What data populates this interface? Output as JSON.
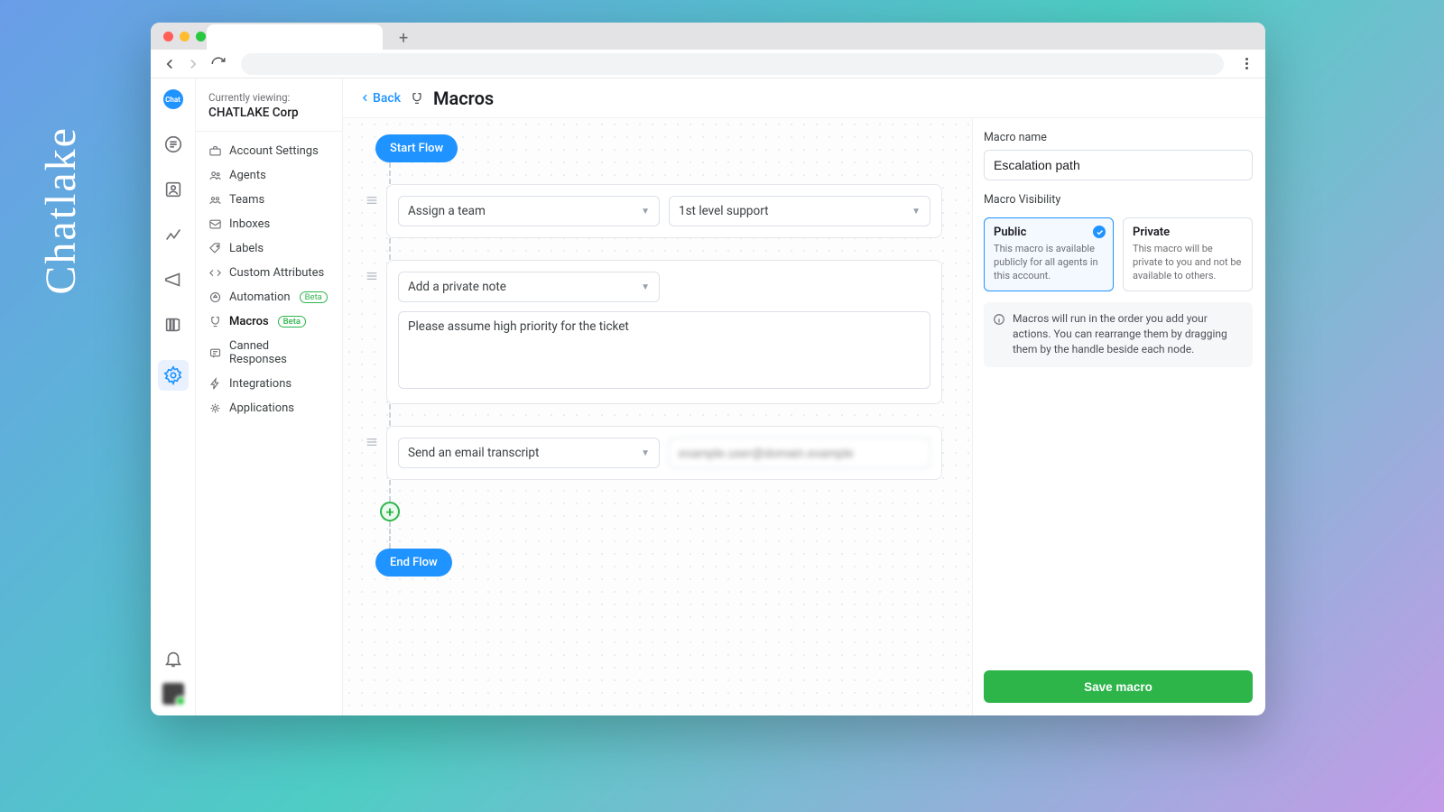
{
  "brand": "Chatlake",
  "browser": {
    "rail_logo_text": "Chat"
  },
  "side": {
    "viewing_label": "Currently viewing:",
    "org_name": "CHATLAKE Corp",
    "items": [
      {
        "label": "Account Settings"
      },
      {
        "label": "Agents"
      },
      {
        "label": "Teams"
      },
      {
        "label": "Inboxes"
      },
      {
        "label": "Labels"
      },
      {
        "label": "Custom Attributes"
      },
      {
        "label": "Automation",
        "beta": true
      },
      {
        "label": "Macros",
        "beta": true
      },
      {
        "label": "Canned Responses"
      },
      {
        "label": "Integrations"
      },
      {
        "label": "Applications"
      }
    ],
    "beta_text": "Beta"
  },
  "header": {
    "back": "Back",
    "title": "Macros"
  },
  "flow": {
    "start": "Start Flow",
    "end": "End Flow",
    "add": "+",
    "nodes": [
      {
        "action": "Assign a team",
        "value": "1st level support"
      },
      {
        "action": "Add a private note",
        "note": "Please assume high priority for the ticket"
      },
      {
        "action": "Send an email transcript",
        "email": "example.user@domain.example"
      }
    ]
  },
  "right": {
    "name_label": "Macro name",
    "name_value": "Escalation path",
    "visibility_label": "Macro Visibility",
    "public": {
      "title": "Public",
      "desc": "This macro is available publicly for all agents in this account."
    },
    "private": {
      "title": "Private",
      "desc": "This macro will be private to you and not be available to others."
    },
    "info": "Macros will run in the order you add your actions. You can rearrange them by dragging them by the handle beside each node.",
    "save": "Save macro"
  }
}
